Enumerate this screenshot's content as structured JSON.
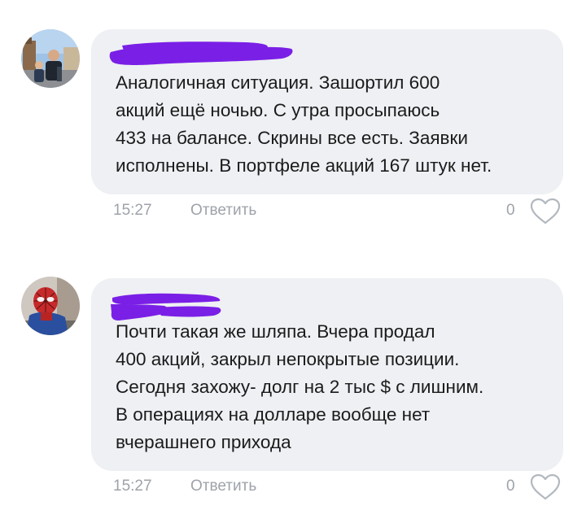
{
  "comments": [
    {
      "avatar": "avatar-photo-person-city",
      "text": "Аналогичная ситуация. Зашортил 600\nакций ещё ночью. С утра просыпаюсь\n433 на балансе. Скрины все есть. Заявки\nисполнены. В портфеле акций 167 штук нет.",
      "time": "15:27",
      "reply_label": "Ответить",
      "likes": "0"
    },
    {
      "avatar": "avatar-photo-spiderman",
      "text": "Почти такая же шляпа. Вчера продал\n400 акций, закрыл непокрытые позиции.\nСегодня захожу- долг на 2 тыс $ с лишним.\nВ операциях на долларе вообще нет\nвчерашнего прихода",
      "time": "15:27",
      "reply_label": "Ответить",
      "likes": "0"
    }
  ],
  "colors": {
    "bubble_bg": "#eef0f3",
    "text": "#1b1b1b",
    "meta_text": "#9ea3aa",
    "redaction": "#7a1fe6"
  },
  "icons": {
    "like": "heart-outline-icon"
  }
}
